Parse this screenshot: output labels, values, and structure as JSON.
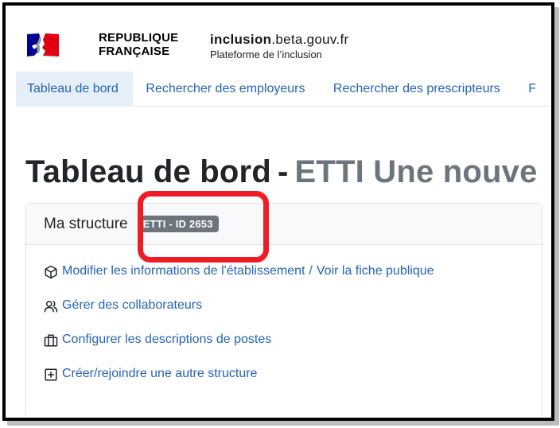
{
  "header": {
    "republic_line1": "REPUBLIQUE",
    "republic_line2": "FRANÇAISE",
    "site_name_bold": "inclusion",
    "site_name_rest": ".beta.gouv.fr",
    "tagline": "Plateforme de l’inclusion"
  },
  "nav": {
    "items": [
      {
        "label": "Tableau de bord",
        "active": true
      },
      {
        "label": "Rechercher des employeurs"
      },
      {
        "label": "Rechercher des prescripteurs"
      },
      {
        "label": "F"
      }
    ]
  },
  "page": {
    "title": "Tableau de bord",
    "separator": "-",
    "org_name": "ETTI Une nouve"
  },
  "card": {
    "title": "Ma structure",
    "badge": "ETTI - ID 2653",
    "links": [
      {
        "label": "Modifier les informations de l'établissement",
        "icon": "cube-icon"
      },
      {
        "label": "Voir la fiche publique"
      },
      {
        "label": "Gérer des collaborateurs",
        "icon": "users-icon"
      },
      {
        "label": "Configurer les descriptions de postes",
        "icon": "briefcase-icon"
      },
      {
        "label": "Créer/rejoindre une autre structure",
        "icon": "plus-square-icon"
      }
    ],
    "link_separator": "/"
  },
  "colors": {
    "link": "#2563b8",
    "badge": "#6c757d",
    "highlight": "#ee1c25",
    "nav_active_bg": "#e6eff8"
  }
}
